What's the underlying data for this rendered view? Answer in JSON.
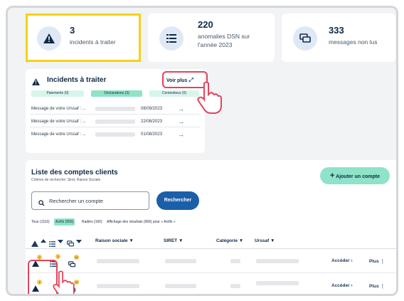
{
  "stats": [
    {
      "value": "3",
      "label": "incidents à traiter",
      "icon": "warning-icon"
    },
    {
      "value": "220",
      "label": "anomalies DSN sur l'année 2023",
      "icon": "list-icon"
    },
    {
      "value": "333",
      "label": "messages non lus",
      "icon": "chat-icon"
    }
  ],
  "incidents": {
    "title": "Incidents à traiter",
    "see_more": "Voir plus",
    "tabs": [
      "Paiements (0)",
      "Déclarations (3)",
      "Contentieux (0)"
    ],
    "rows": [
      {
        "label": "Message de votre Urssaf : ...",
        "date": "08/09/2023"
      },
      {
        "label": "Message de votre Urssaf : ...",
        "date": "22/08/2023"
      },
      {
        "label": "Message de votre Urssaf : ...",
        "date": "01/08/2023"
      }
    ]
  },
  "accounts": {
    "title": "Liste des comptes clients",
    "criteria": "Critères de recherche: Siret, Raison Sociale",
    "add_button": "Ajouter un compte",
    "search_placeholder": "Rechercher un compte",
    "search_button": "Rechercher",
    "filters": [
      "Tous (1116)",
      "Actifs (956)",
      "Radiés (160)"
    ],
    "result_text": "Affichage des résultats (956) pour « Actifs »",
    "columns": [
      "Raison sociale",
      "SIRET",
      "Catégorie",
      "Urssaf"
    ],
    "row_actions": {
      "access": "Accéder",
      "more": "Plus"
    },
    "badges": [
      "2",
      "1",
      "12",
      "12"
    ]
  },
  "colors": {
    "accent": "#1b5fa8",
    "highlight": "#f5d216",
    "callout": "#e2445c",
    "mint": "#8ee3c8"
  }
}
